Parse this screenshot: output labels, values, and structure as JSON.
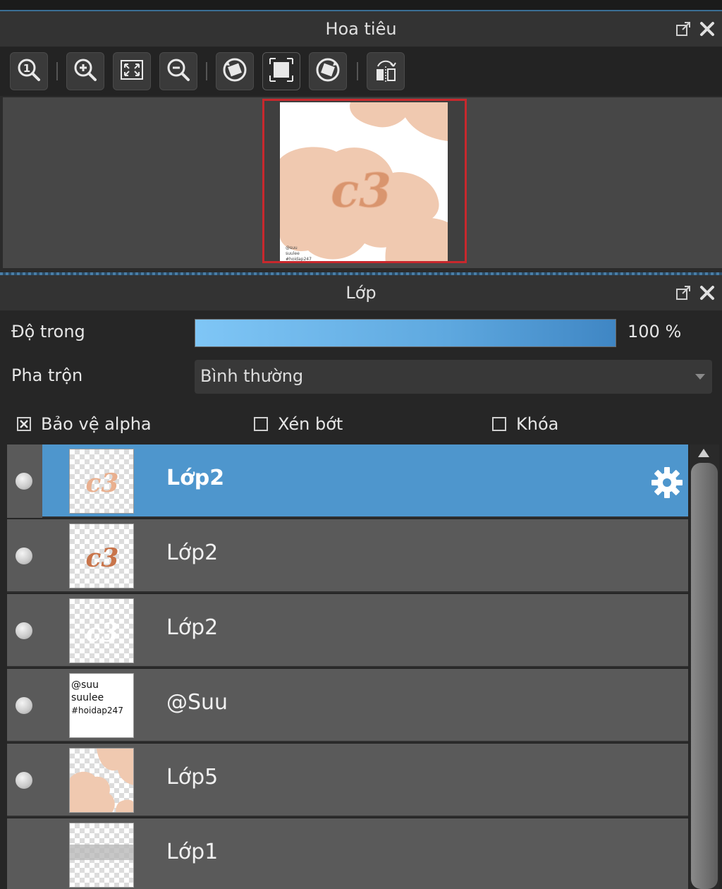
{
  "navigator": {
    "title": "Hoa tiêu",
    "toolbar": [
      {
        "icon": "zoom-actual-icon"
      },
      {
        "icon": "zoom-in-icon"
      },
      {
        "icon": "fit-screen-icon"
      },
      {
        "icon": "zoom-out-icon"
      },
      {
        "icon": "rotate-left-icon"
      },
      {
        "icon": "reset-rotation-icon"
      },
      {
        "icon": "rotate-right-icon"
      },
      {
        "icon": "flip-horizontal-icon"
      }
    ],
    "preview": {
      "logo_text": "c3",
      "watermark_lines": [
        "@suu",
        "suulee",
        "#hoidap247"
      ]
    }
  },
  "layers_panel": {
    "title": "Lớp",
    "opacity_label": "Độ trong",
    "opacity_value": "100 %",
    "opacity_fraction": 1.0,
    "blend_label": "Pha trộn",
    "blend_value": "Bình thường",
    "protect_alpha_label": "Bảo vệ alpha",
    "protect_alpha_checked": true,
    "clipping_label": "Xén bớt",
    "clipping_checked": false,
    "lock_label": "Khóa",
    "lock_checked": false,
    "layers": [
      {
        "name": "Lớp2",
        "selected": true,
        "thumb_text": "c3"
      },
      {
        "name": "Lớp2",
        "selected": false,
        "thumb_text": "c3"
      },
      {
        "name": "Lớp2",
        "selected": false,
        "thumb_text": "c3"
      },
      {
        "name": "@Suu",
        "selected": false,
        "thumb_lines": [
          "@suu",
          "suulee",
          "#hoidap247"
        ]
      },
      {
        "name": "Lớp5",
        "selected": false
      },
      {
        "name": "Lớp1",
        "selected": false
      }
    ]
  },
  "colors": {
    "accent": "#4e96cd",
    "preview_border": "#c8282d",
    "peach": "#f0c9b0"
  }
}
